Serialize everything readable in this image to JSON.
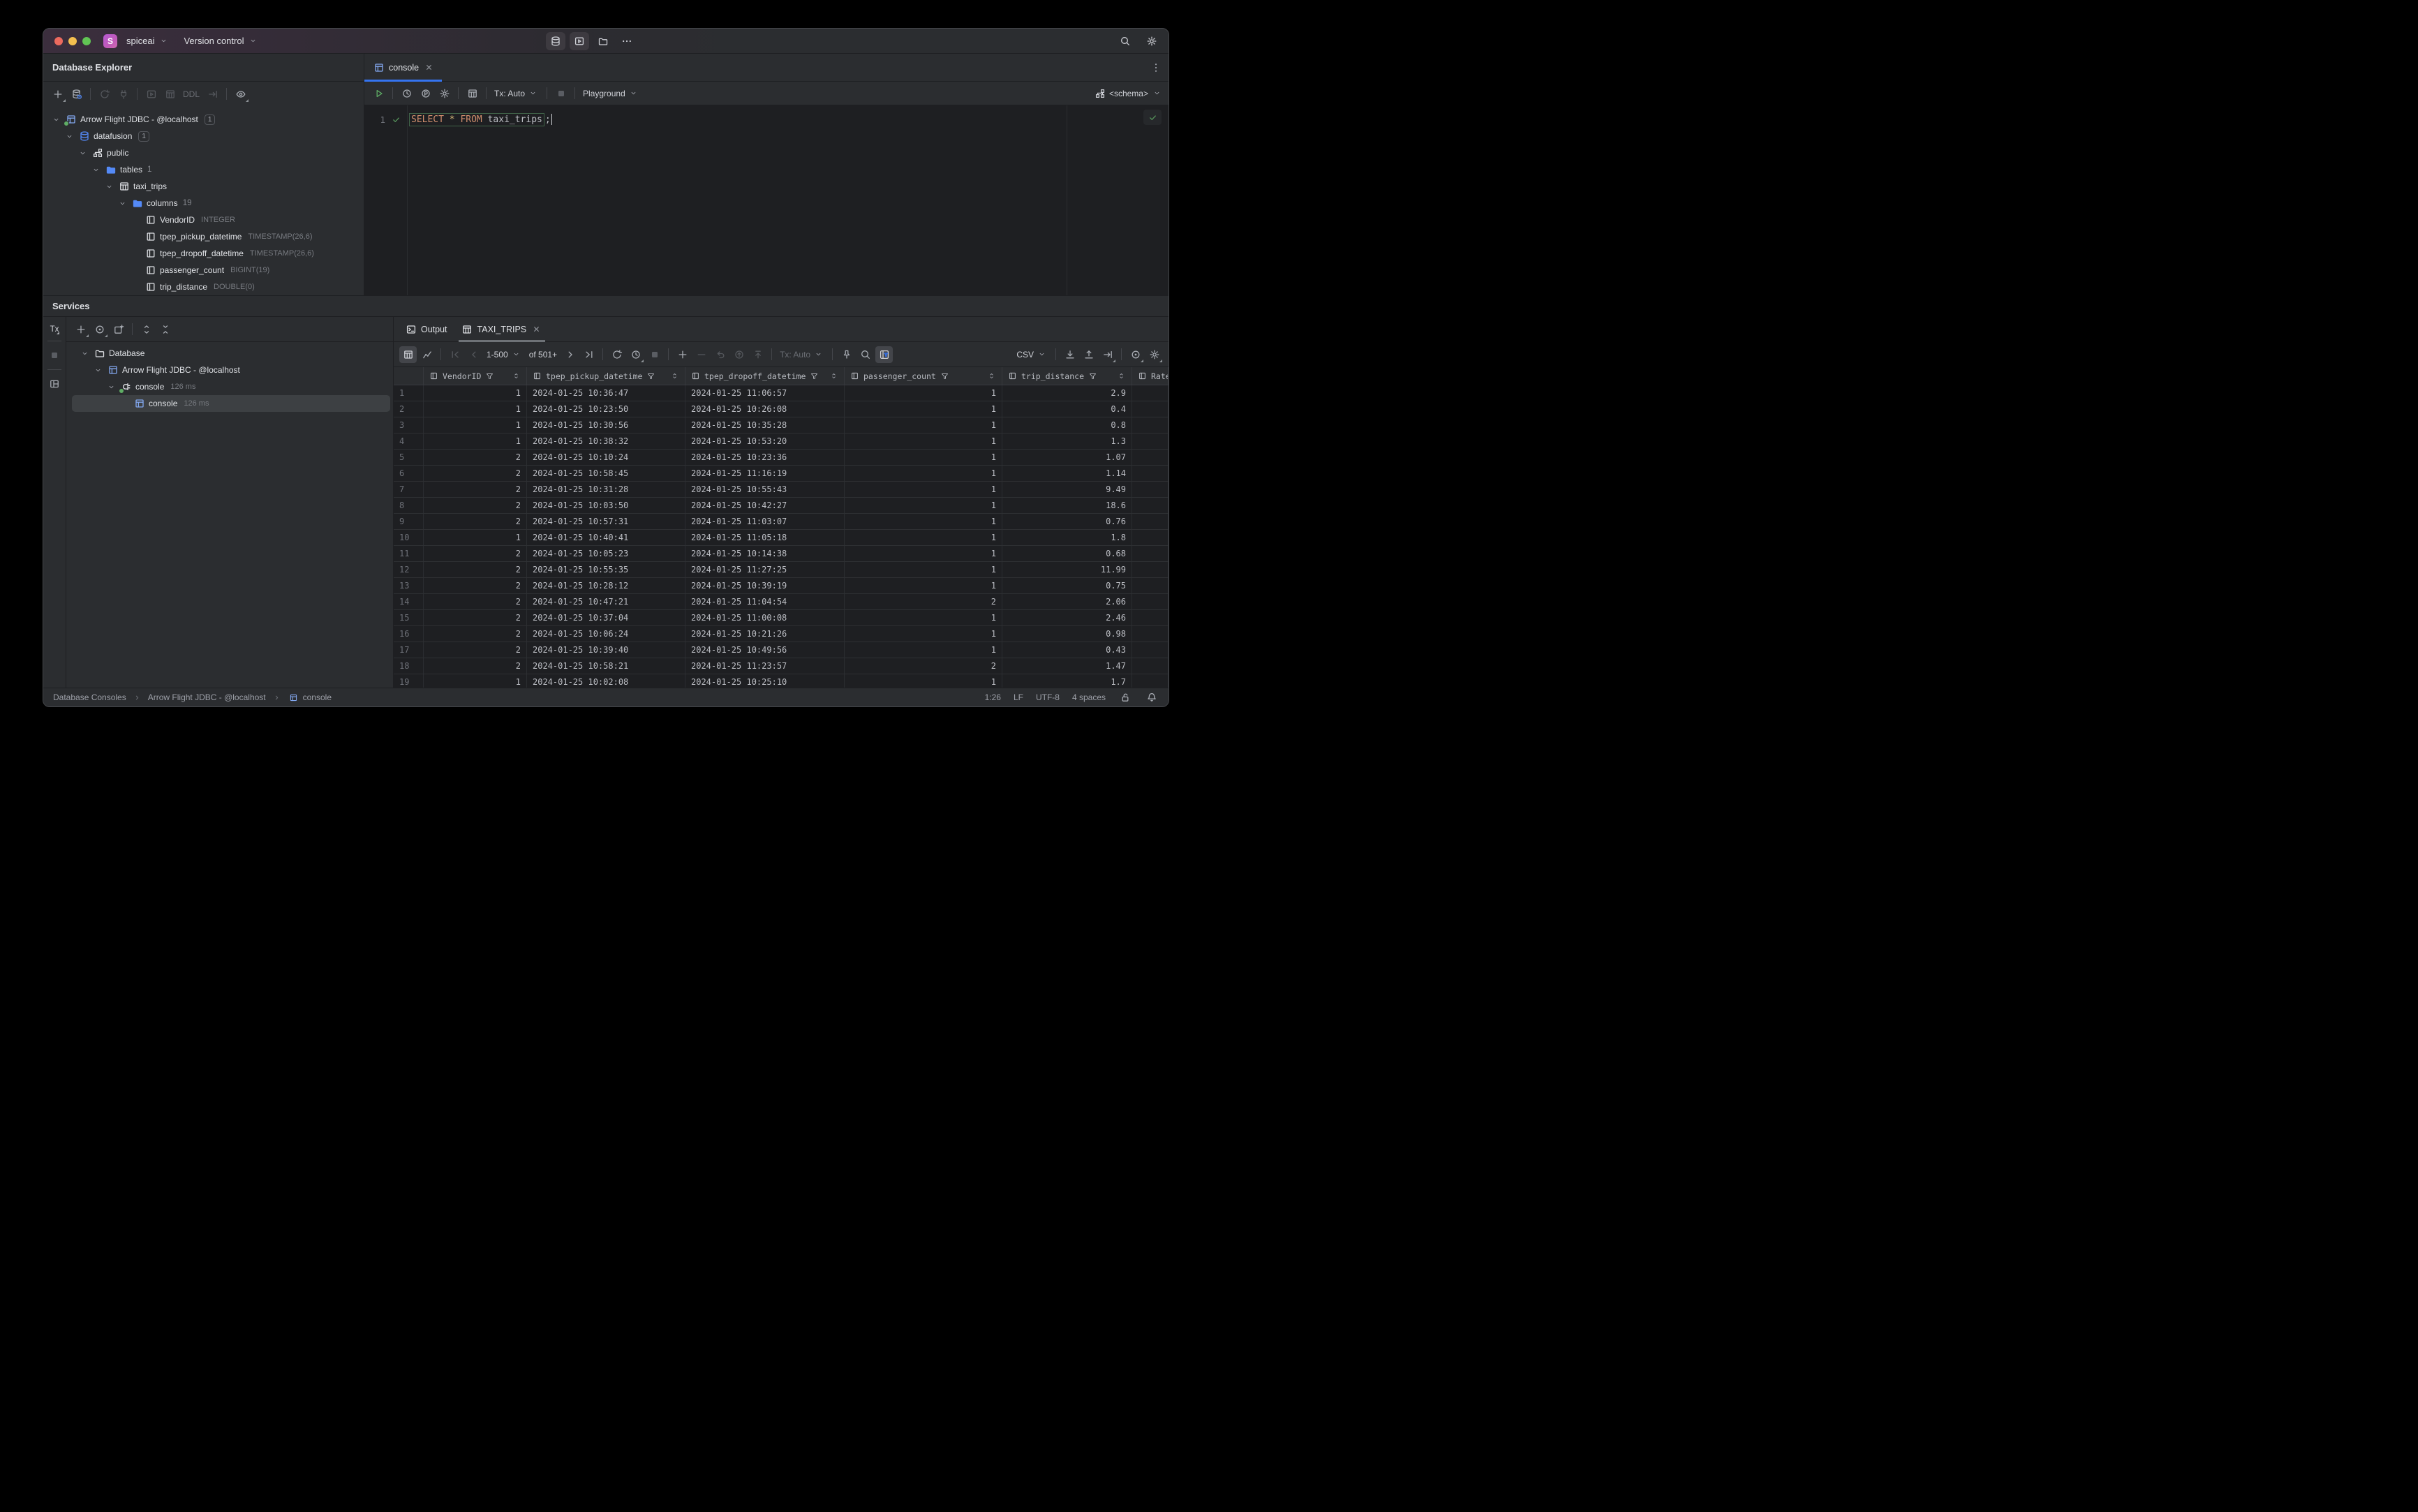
{
  "colors": {
    "accent": "#3574f0",
    "run_green": "#5fad65",
    "check_green": "#57965c",
    "folder_blue": "#548af7",
    "window_bg": "#2b2d30",
    "editor_bg": "#1e1f22",
    "keyword_orange": "#cf8e6d",
    "star_yellow": "#d5b778"
  },
  "titlebar": {
    "project": "spiceai",
    "project_badge": "S",
    "menu": "Version control",
    "center_icons": [
      {
        "icon": "database",
        "name": "database-tool",
        "boxed": true
      },
      {
        "icon": "run-window",
        "name": "run-tool",
        "boxed": true
      },
      {
        "icon": "folder-gray",
        "name": "project-files"
      },
      {
        "icon": "more-h",
        "name": "more-tools"
      }
    ],
    "right_icons": [
      {
        "icon": "search",
        "name": "search-everywhere"
      },
      {
        "icon": "gear",
        "name": "settings"
      }
    ]
  },
  "database_explorer": {
    "title": "Database Explorer",
    "toolbar": [
      {
        "icon": "plus",
        "name": "new-datasource",
        "corner": true
      },
      {
        "icon": "db-gear",
        "name": "datasource-properties"
      },
      {
        "sep": true
      },
      {
        "icon": "refresh",
        "name": "refresh",
        "disabled": true
      },
      {
        "icon": "unplug",
        "name": "disconnect",
        "disabled": true
      },
      {
        "sep": true
      },
      {
        "icon": "run-window",
        "name": "jump-to-console",
        "disabled": true
      },
      {
        "icon": "table",
        "name": "open-data",
        "disabled": true
      },
      {
        "label": "DDL",
        "name": "open-ddl",
        "disabled": true
      },
      {
        "icon": "export",
        "name": "export-data",
        "disabled": true
      },
      {
        "sep": true
      },
      {
        "icon": "eye",
        "name": "view-options",
        "corner": true
      }
    ],
    "tree": [
      {
        "level": 0,
        "twist": "open",
        "icon": "datasource",
        "dot": true,
        "label": "Arrow Flight JDBC - @localhost",
        "badge": "1"
      },
      {
        "level": 1,
        "twist": "open",
        "icon": "database",
        "iconClass": "ic-blue",
        "label": "datafusion",
        "badge": "1"
      },
      {
        "level": 2,
        "twist": "open",
        "icon": "schema",
        "label": "public"
      },
      {
        "level": 3,
        "twist": "open",
        "icon": "folder",
        "label": "tables",
        "count": "1"
      },
      {
        "level": 4,
        "twist": "open",
        "icon": "table",
        "label": "taxi_trips"
      },
      {
        "level": 5,
        "twist": "open",
        "icon": "folder",
        "label": "columns",
        "count": "19"
      },
      {
        "level": 6,
        "twist": "none",
        "icon": "column",
        "label": "VendorID",
        "meta": "INTEGER"
      },
      {
        "level": 6,
        "twist": "none",
        "icon": "column",
        "label": "tpep_pickup_datetime",
        "meta": "TIMESTAMP(26,6)"
      },
      {
        "level": 6,
        "twist": "none",
        "icon": "column",
        "label": "tpep_dropoff_datetime",
        "meta": "TIMESTAMP(26,6)"
      },
      {
        "level": 6,
        "twist": "none",
        "icon": "column",
        "label": "passenger_count",
        "meta": "BIGINT(19)"
      },
      {
        "level": 6,
        "twist": "none",
        "icon": "column",
        "label": "trip_distance",
        "meta": "DOUBLE(0)"
      }
    ]
  },
  "editor": {
    "tab": {
      "label": "console"
    },
    "toolbar": [
      {
        "icon": "run",
        "name": "execute",
        "green": true
      },
      {
        "sep": true
      },
      {
        "icon": "clock",
        "name": "query-history"
      },
      {
        "icon": "circle-p",
        "name": "parameters"
      },
      {
        "icon": "gear",
        "name": "console-settings"
      },
      {
        "sep": true
      },
      {
        "icon": "table",
        "name": "browse-data"
      },
      {
        "sep": true
      },
      {
        "label": "Tx: Auto",
        "name": "tx-mode",
        "chevron": true
      },
      {
        "sep": true
      },
      {
        "icon": "stop",
        "name": "stop",
        "disabled": true
      },
      {
        "sep": true
      },
      {
        "label": "Playground",
        "name": "console-mode",
        "chevron": true
      }
    ],
    "schema_selector": {
      "label": "<schema>"
    },
    "line_number": "1",
    "sql": {
      "tokens": [
        [
          "kw",
          "SELECT"
        ],
        [
          "pl",
          " "
        ],
        [
          "star",
          "*"
        ],
        [
          "pl",
          " "
        ],
        [
          "kw",
          "FROM"
        ],
        [
          "pl",
          " "
        ],
        [
          "pl",
          "taxi_trips"
        ]
      ],
      "tail": ";"
    }
  },
  "services": {
    "title": "Services",
    "strip": [
      {
        "label": "Tx",
        "name": "tx-quick",
        "corner": true
      },
      {
        "divider": true
      },
      {
        "icon": "stop",
        "name": "stop-process"
      },
      {
        "divider": true
      },
      {
        "icon": "layout",
        "name": "split-layout"
      }
    ],
    "toolbar": [
      {
        "icon": "plus",
        "name": "add-service",
        "corner": true
      },
      {
        "icon": "target",
        "name": "show-options",
        "corner": true
      },
      {
        "icon": "opennew",
        "name": "open-each-in-new-tab"
      },
      {
        "sep": true
      },
      {
        "icon": "expand",
        "name": "expand-all"
      },
      {
        "icon": "collapse",
        "name": "collapse-all"
      }
    ],
    "tree": [
      {
        "level": 0,
        "twist": "open",
        "icon": "folder-gray",
        "label": "Database"
      },
      {
        "level": 1,
        "twist": "open",
        "icon": "datasource",
        "label": "Arrow Flight JDBC - @localhost"
      },
      {
        "level": 2,
        "twist": "open",
        "icon": "plug",
        "dot": true,
        "label": "console",
        "meta": "126 ms"
      },
      {
        "level": 3,
        "twist": "none",
        "icon": "datasource",
        "label": "console",
        "meta": "126 ms",
        "selected": true
      }
    ]
  },
  "results": {
    "tabs": [
      {
        "icon": "terminal",
        "label": "Output",
        "name": "tab-output"
      },
      {
        "icon": "table",
        "label": "TAXI_TRIPS",
        "close": true,
        "active": true,
        "name": "tab-taxi-trips"
      }
    ],
    "toolbar": [
      {
        "icon": "table",
        "name": "data-view",
        "active": true
      },
      {
        "icon": "chart",
        "name": "chart-view"
      },
      {
        "sep": true
      },
      {
        "icon": "first",
        "name": "first-page",
        "disabled": true
      },
      {
        "icon": "prev",
        "name": "previous-page",
        "disabled": true
      },
      {
        "label": "1-500",
        "name": "page-size",
        "chevron": true
      },
      {
        "label": "of 501+",
        "name": "row-count",
        "plain": true
      },
      {
        "icon": "next",
        "name": "next-page"
      },
      {
        "icon": "last",
        "name": "last-page"
      },
      {
        "sep": true
      },
      {
        "icon": "refresh",
        "name": "reload-page"
      },
      {
        "icon": "clock",
        "name": "auto-refresh",
        "corner": true
      },
      {
        "icon": "stop",
        "name": "stop-query",
        "disabled": true
      },
      {
        "sep": true
      },
      {
        "icon": "plus",
        "name": "add-row"
      },
      {
        "icon": "minus",
        "name": "delete-row",
        "disabled": true
      },
      {
        "icon": "undo",
        "name": "revert-changes",
        "disabled": true
      },
      {
        "icon": "revert",
        "name": "rollback",
        "disabled": true
      },
      {
        "icon": "commit",
        "name": "submit",
        "disabled": true
      },
      {
        "sep": true
      },
      {
        "label": "Tx: Auto",
        "name": "tx-mode-grid",
        "chevron": true,
        "disabled": true
      },
      {
        "sep": true
      },
      {
        "icon": "pin",
        "name": "pin-tab"
      },
      {
        "icon": "search",
        "name": "find-in-grid"
      },
      {
        "icon": "filter-panel",
        "name": "filter-panel",
        "active": true
      }
    ],
    "toolbar_right": [
      {
        "label": "CSV",
        "name": "export-format",
        "chevron": true
      },
      {
        "sep": true
      },
      {
        "icon": "download",
        "name": "import"
      },
      {
        "icon": "upload",
        "name": "export"
      },
      {
        "icon": "export",
        "name": "dump-data",
        "corner": true
      },
      {
        "sep": true
      },
      {
        "icon": "target",
        "name": "view-options-grid",
        "corner": true
      },
      {
        "icon": "gear",
        "name": "grid-settings",
        "corner": true
      }
    ]
  },
  "table": {
    "columns": [
      {
        "name": "VendorID",
        "align": "r"
      },
      {
        "name": "tpep_pickup_datetime",
        "align": "l"
      },
      {
        "name": "tpep_dropoff_datetime",
        "align": "l"
      },
      {
        "name": "passenger_count",
        "align": "r"
      },
      {
        "name": "trip_distance",
        "align": "r"
      },
      {
        "name": "Rate",
        "align": "l",
        "clipped": true
      }
    ],
    "rows": [
      [
        "1",
        "2024-01-25 10:36:47",
        "2024-01-25 11:06:57",
        "1",
        "2.9",
        ""
      ],
      [
        "1",
        "2024-01-25 10:23:50",
        "2024-01-25 10:26:08",
        "1",
        "0.4",
        ""
      ],
      [
        "1",
        "2024-01-25 10:30:56",
        "2024-01-25 10:35:28",
        "1",
        "0.8",
        ""
      ],
      [
        "1",
        "2024-01-25 10:38:32",
        "2024-01-25 10:53:20",
        "1",
        "1.3",
        ""
      ],
      [
        "2",
        "2024-01-25 10:10:24",
        "2024-01-25 10:23:36",
        "1",
        "1.07",
        ""
      ],
      [
        "2",
        "2024-01-25 10:58:45",
        "2024-01-25 11:16:19",
        "1",
        "1.14",
        ""
      ],
      [
        "2",
        "2024-01-25 10:31:28",
        "2024-01-25 10:55:43",
        "1",
        "9.49",
        ""
      ],
      [
        "2",
        "2024-01-25 10:03:50",
        "2024-01-25 10:42:27",
        "1",
        "18.6",
        ""
      ],
      [
        "2",
        "2024-01-25 10:57:31",
        "2024-01-25 11:03:07",
        "1",
        "0.76",
        ""
      ],
      [
        "1",
        "2024-01-25 10:40:41",
        "2024-01-25 11:05:18",
        "1",
        "1.8",
        ""
      ],
      [
        "2",
        "2024-01-25 10:05:23",
        "2024-01-25 10:14:38",
        "1",
        "0.68",
        ""
      ],
      [
        "2",
        "2024-01-25 10:55:35",
        "2024-01-25 11:27:25",
        "1",
        "11.99",
        ""
      ],
      [
        "2",
        "2024-01-25 10:28:12",
        "2024-01-25 10:39:19",
        "1",
        "0.75",
        ""
      ],
      [
        "2",
        "2024-01-25 10:47:21",
        "2024-01-25 11:04:54",
        "2",
        "2.06",
        ""
      ],
      [
        "2",
        "2024-01-25 10:37:04",
        "2024-01-25 11:00:08",
        "1",
        "2.46",
        ""
      ],
      [
        "2",
        "2024-01-25 10:06:24",
        "2024-01-25 10:21:26",
        "1",
        "0.98",
        ""
      ],
      [
        "2",
        "2024-01-25 10:39:40",
        "2024-01-25 10:49:56",
        "1",
        "0.43",
        ""
      ],
      [
        "2",
        "2024-01-25 10:58:21",
        "2024-01-25 11:23:57",
        "2",
        "1.47",
        ""
      ],
      [
        "1",
        "2024-01-25 10:02:08",
        "2024-01-25 10:25:10",
        "1",
        "1.7",
        ""
      ]
    ]
  },
  "statusbar": {
    "breadcrumbs": [
      {
        "label": "Database Consoles"
      },
      {
        "label": "Arrow Flight JDBC - @localhost"
      },
      {
        "icon": "datasource",
        "label": "console"
      }
    ],
    "right": [
      "1:26",
      "LF",
      "UTF-8",
      "4 spaces"
    ],
    "right_icons": [
      {
        "icon": "lock-open",
        "name": "writable-toggle"
      },
      {
        "icon": "bell",
        "name": "notifications"
      }
    ]
  }
}
